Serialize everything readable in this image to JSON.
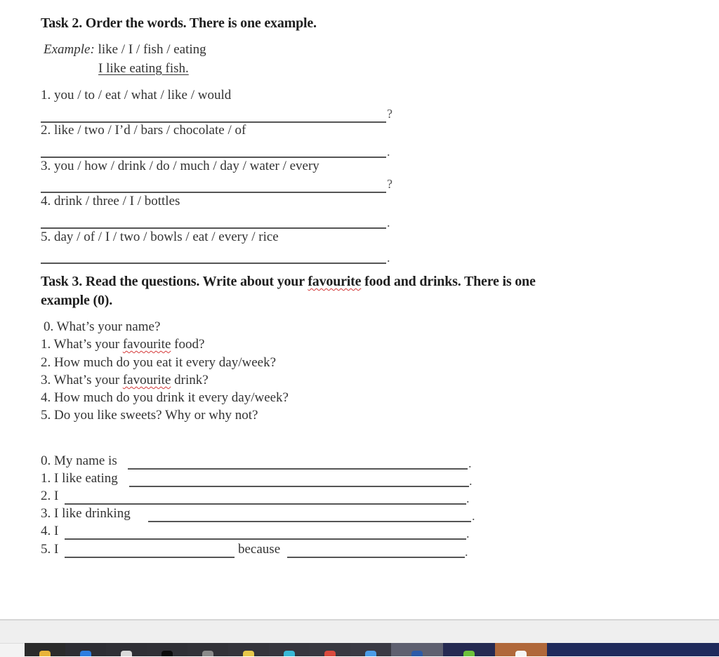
{
  "task2": {
    "heading": "Task 2. Order the words. There is one example.",
    "example_label": "Example:",
    "example_words": " like / I / fish / eating",
    "example_answer": "I like eating fish.",
    "items": [
      {
        "prompt": "1. you / to / eat / what / like / would",
        "end": "?"
      },
      {
        "prompt": "2. like / two / I’d / bars / chocolate / of",
        "end": "."
      },
      {
        "prompt": "3. you / how / drink / do / much / day / water / every",
        "end": "?"
      },
      {
        "prompt": "4. drink / three / I / bottles",
        "end": "."
      },
      {
        "prompt": "5. day / of / I / two / bowls / eat / every / rice",
        "end": "."
      }
    ]
  },
  "task3": {
    "heading_part1": "Task 3. Read the questions. Write about your ",
    "heading_word": "favourite",
    "heading_part2": " food and drinks. There is one",
    "heading_line2": "example (0).",
    "questions": [
      {
        "pre": "0. What’s your name?",
        "word": "",
        "post": ""
      },
      {
        "pre": "1. What’s your ",
        "word": "favourite",
        "post": " food?"
      },
      {
        "pre": "2. How much do you eat it every day/week?",
        "word": "",
        "post": ""
      },
      {
        "pre": "3. What’s your ",
        "word": "favourite",
        "post": " drink?"
      },
      {
        "pre": "4. How much do you drink it every day/week?",
        "word": "",
        "post": ""
      },
      {
        "pre": "5. Do you like sweets? Why or why not?",
        "word": "",
        "post": ""
      }
    ],
    "answers": [
      {
        "stem": "0. My name is",
        "end": "."
      },
      {
        "stem": "1. I like eating",
        "end": "."
      },
      {
        "stem": "2. I",
        "end": "."
      },
      {
        "stem": "3. I like drinking",
        "end": "."
      },
      {
        "stem": "4. I",
        "end": "."
      },
      {
        "stem": "5. I",
        "middle": "because",
        "end": "."
      }
    ]
  },
  "taskbar": {
    "icons": [
      {
        "name": "file-explorer-icon",
        "color": "#e8b43a"
      },
      {
        "name": "app-blue-icon",
        "color": "#2f7de0"
      },
      {
        "name": "store-icon",
        "color": "#d9d9d9"
      },
      {
        "name": "terminal-icon",
        "color": "#0a0a0a"
      },
      {
        "name": "app-gray-icon",
        "color": "#8a8a8a"
      },
      {
        "name": "internet-explorer-icon",
        "color": "#e6c84a"
      },
      {
        "name": "app-cyan-icon",
        "color": "#37b8d6"
      },
      {
        "name": "chrome-icon",
        "color": "#d94a3d"
      },
      {
        "name": "app-lightblue-icon",
        "color": "#4a9ce8"
      },
      {
        "name": "word-icon",
        "color": "#2b5aa8"
      },
      {
        "name": "app-green-icon",
        "color": "#6cc13a"
      },
      {
        "name": "app-white-icon",
        "color": "#f5f5f5"
      }
    ]
  }
}
